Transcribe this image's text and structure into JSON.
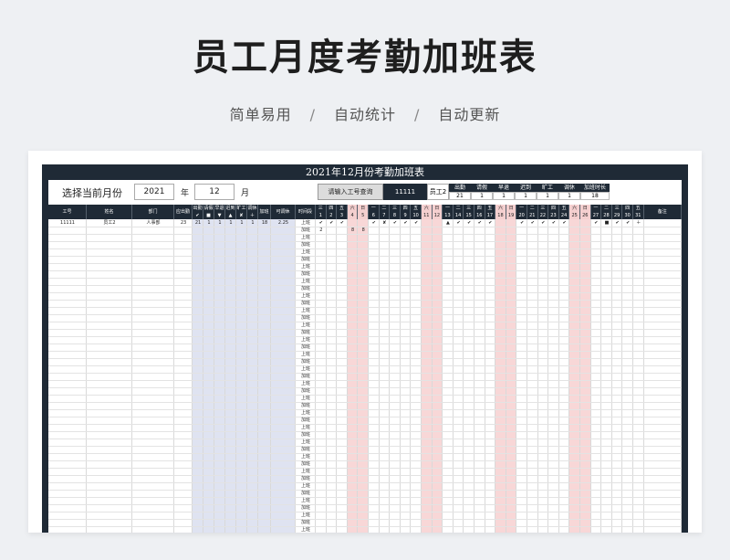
{
  "hero": {
    "title": "员工月度考勤加班表",
    "subtitle": [
      "简单易用",
      "自动统计",
      "自动更新"
    ],
    "separator": "/"
  },
  "sheet": {
    "title": "2021年12月份考勤加班表",
    "select_label": "选择当前月份",
    "year": "2021",
    "year_unit": "年",
    "month": "12",
    "month_unit": "月",
    "query_button": "请输入工号查询",
    "query_id": "11111",
    "query_name": "员工2"
  },
  "summary": {
    "labels": [
      "出勤",
      "请假",
      "早退",
      "迟到",
      "旷工",
      "调休",
      "加班时长"
    ],
    "values": [
      "21",
      "1",
      "1",
      "1",
      "1",
      "1",
      "18"
    ]
  },
  "headers": {
    "id": "工号",
    "name": "姓名",
    "dept": "部门",
    "due_days": "应出勤天数",
    "stats": [
      {
        "label": "出勤",
        "icon": "✔"
      },
      {
        "label": "请假",
        "icon": "■"
      },
      {
        "label": "早退",
        "icon": "▼"
      },
      {
        "label": "迟到",
        "icon": "▲"
      },
      {
        "label": "旷工",
        "icon": "✘"
      },
      {
        "label": "调休",
        "icon": "＋"
      }
    ],
    "overtime": "加班",
    "rest": "可调休",
    "period": "时间段",
    "remark": "备注"
  },
  "weekdays": [
    "三",
    "四",
    "五",
    "六",
    "日",
    "一",
    "二",
    "三",
    "四",
    "五",
    "六",
    "日",
    "一",
    "二",
    "三",
    "四",
    "五",
    "六",
    "日",
    "一",
    "二",
    "三",
    "四",
    "五",
    "六",
    "日",
    "一",
    "二",
    "三",
    "四",
    "五"
  ],
  "row": {
    "id": "11111",
    "name": "员工2",
    "dept": "人事部",
    "due_days": "23",
    "stats": [
      "21",
      "1",
      "1",
      "1",
      "1",
      "1"
    ],
    "overtime": "18",
    "rest": "2.25",
    "periods": [
      "上班",
      "加班"
    ],
    "attendance": [
      "✔",
      "✔",
      "✔",
      "",
      "",
      "✔",
      "✘",
      "✔",
      "✔",
      "✔",
      "",
      "",
      "▲",
      "✔",
      "✔",
      "✔",
      "✔",
      "",
      "",
      "✔",
      "✔",
      "✔",
      "✔",
      "✔",
      "",
      "",
      "✔",
      "■",
      "✔",
      "✔",
      "＋"
    ],
    "overtime_hours": [
      "2",
      "",
      "",
      "8",
      "8",
      "",
      "",
      "",
      "",
      "",
      "",
      "",
      "",
      "",
      "",
      "",
      "",
      "",
      "",
      "",
      "",
      "",
      "",
      "",
      "",
      "",
      "",
      "",
      "",
      "",
      ""
    ]
  }
}
